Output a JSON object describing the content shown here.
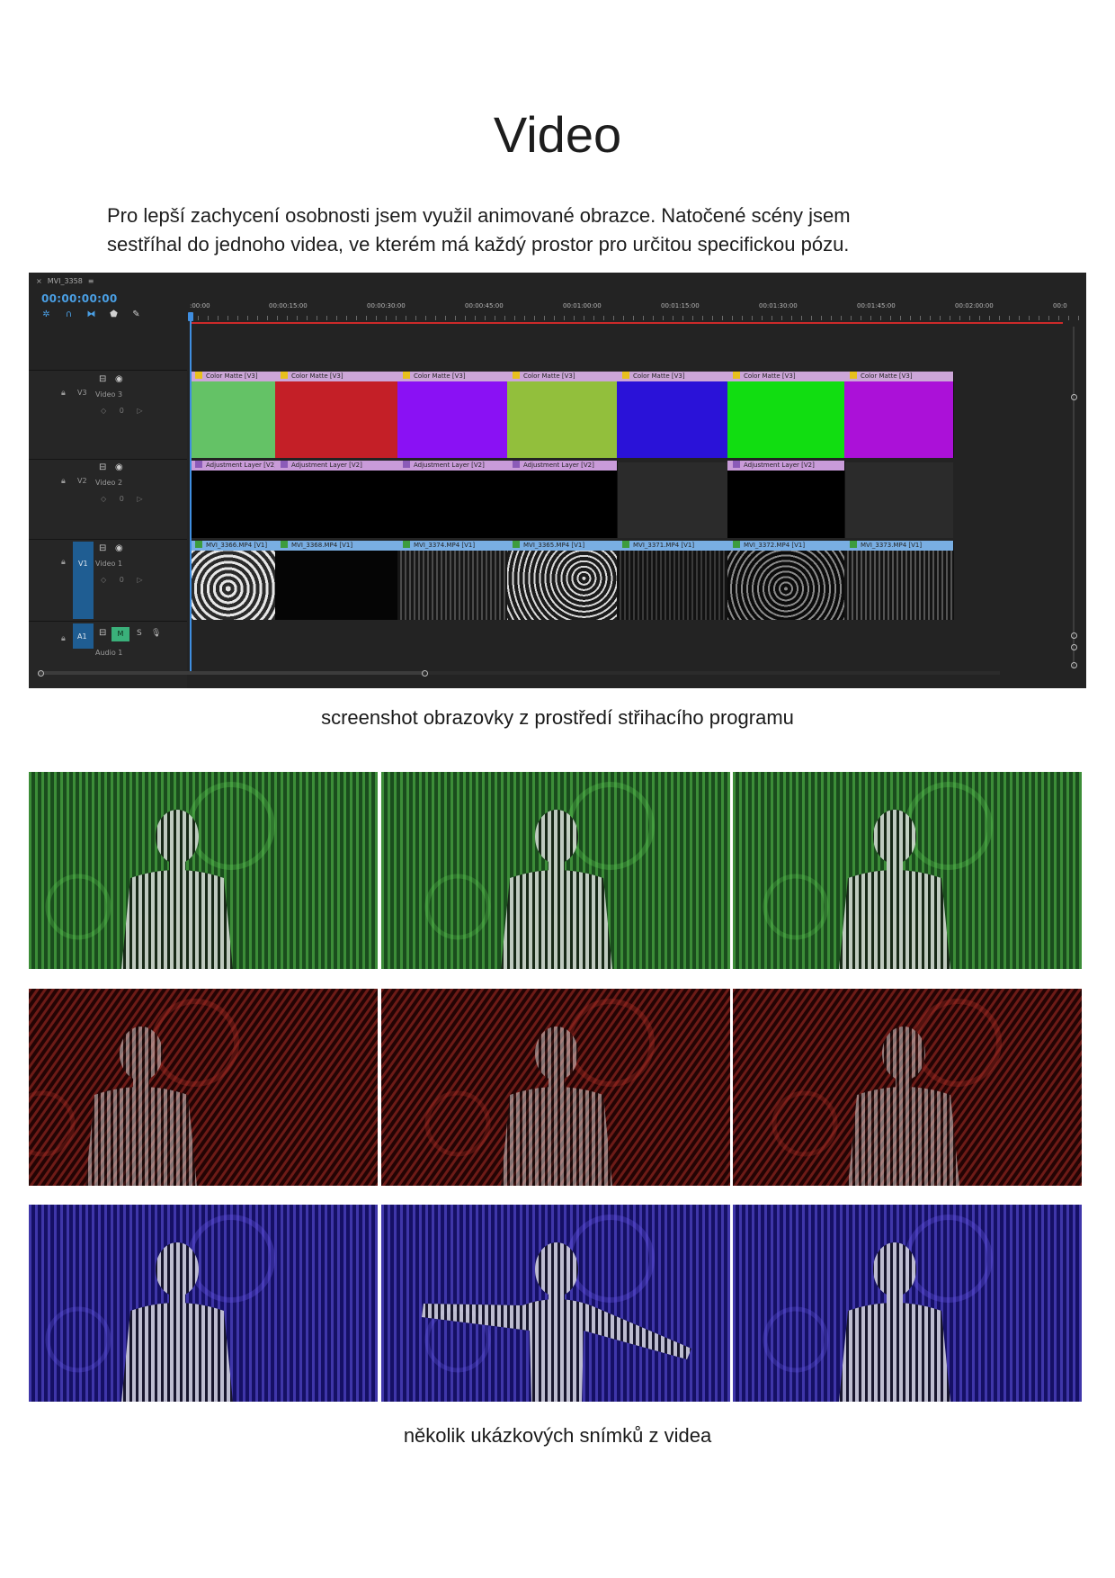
{
  "page": {
    "title": "Video",
    "intro_line1": "Pro lepší zachycení osobnosti jsem využil animované obrazce. Natočené scény jsem",
    "intro_line2": "sestříhal do jednoho videa, ve kterém má každý prostor pro určitou specifickou pózu.",
    "caption_editor": "screenshot obrazovky z prostředí střihacího programu",
    "caption_frames": "několik ukázkových snímků z videa"
  },
  "editor": {
    "sequence_tab": "MVI_3358",
    "timecode": "00:00:00:00",
    "tools": [
      "snap-icon",
      "magnet-icon",
      "linked-selection-icon",
      "marker-icon",
      "wrench-icon"
    ],
    "ruler_ticks": [
      ":00:00",
      "00:00:15:00",
      "00:00:30:00",
      "00:00:45:00",
      "00:01:00:00",
      "00:01:15:00",
      "00:01:30:00",
      "00:01:45:00",
      "00:02:00:00",
      "00:0"
    ],
    "tracks": [
      {
        "id": "V3",
        "name": "Video 3",
        "sub": "◇ 0 ▷"
      },
      {
        "id": "V2",
        "name": "Video 2",
        "sub": "◇ 0 ▷"
      },
      {
        "id": "V1",
        "name": "Video 1",
        "sub": "◇ 0 ▷"
      },
      {
        "id": "A1",
        "name": "Audio 1",
        "toggle": "M",
        "solo": "S"
      }
    ],
    "v3_clips": [
      {
        "label": "Color Matte [V3]",
        "color": "#64c266"
      },
      {
        "label": "Color Matte [V3]",
        "color": "#c41f27"
      },
      {
        "label": "Color Matte [V3]",
        "color": "#8a11f4"
      },
      {
        "label": "Color Matte [V3]",
        "color": "#92bf3c"
      },
      {
        "label": "Color Matte [V3]",
        "color": "#2a12d8"
      },
      {
        "label": "Color Matte [V3]",
        "color": "#11dd11"
      },
      {
        "label": "Color Matte [V3]",
        "color": "#ab11d8"
      }
    ],
    "v2_clips": [
      {
        "label": "Adjustment Layer [V2]"
      },
      {
        "label": "Adjustment Layer [V2]"
      },
      {
        "label": "Adjustment Layer [V2]"
      },
      {
        "label": "Adjustment Layer [V2]"
      },
      {
        "label": "Adjustment Layer [V2]"
      }
    ],
    "v1_clips": [
      {
        "label": "MVI_3366.MP4 [V1]"
      },
      {
        "label": "MVI_3368.MP4 [V1]"
      },
      {
        "label": "MVI_3374.MP4 [V1]"
      },
      {
        "label": "MVI_3365.MP4 [V1]"
      },
      {
        "label": "MVI_3371.MP4 [V1]"
      },
      {
        "label": "MVI_3372.MP4 [V1]"
      },
      {
        "label": "MVI_3373.MP4 [V1]"
      }
    ]
  },
  "frames": {
    "rows": [
      {
        "theme": "green",
        "bg": "#1a4d1d",
        "accent": "#5fcf55",
        "stripe": "vertical"
      },
      {
        "theme": "red",
        "bg": "#240404",
        "accent": "#c3342c",
        "stripe": "diagonal"
      },
      {
        "theme": "blue",
        "bg": "#161066",
        "accent": "#6b5cf0",
        "stripe": "vertical"
      }
    ]
  }
}
